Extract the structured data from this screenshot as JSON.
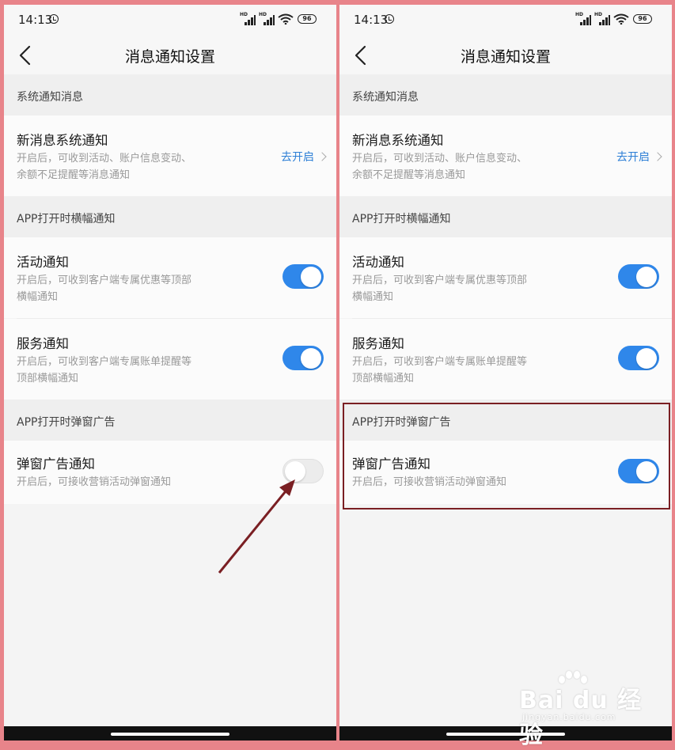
{
  "status": {
    "time": "14:13",
    "hd": "HD",
    "battery": "96"
  },
  "nav": {
    "title": "消息通知设置"
  },
  "sections": {
    "system": {
      "header": "系统通知消息"
    },
    "banner": {
      "header": "APP打开时横幅通知"
    },
    "popup": {
      "header": "APP打开时弹窗广告"
    }
  },
  "rows": {
    "new_message": {
      "title": "新消息系统通知",
      "desc_line1": "开启后，可收到活动、账户信息变动、",
      "desc_line2": "余额不足提醒等消息通知",
      "action": "去开启"
    },
    "activity": {
      "title": "活动通知",
      "desc_line1": "开启后，可收到客户端专属优惠等顶部",
      "desc_line2": "横幅通知"
    },
    "service": {
      "title": "服务通知",
      "desc_line1": "开启后，可收到客户端专属账单提醒等",
      "desc_line2": "顶部横幅通知"
    },
    "popup_ad": {
      "title": "弹窗广告通知",
      "desc": "开启后，可接收营销活动弹窗通知"
    }
  },
  "toggles": {
    "left": {
      "activity": true,
      "service": true,
      "popup_ad": false
    },
    "right": {
      "activity": true,
      "service": true,
      "popup_ad": true
    }
  },
  "colors": {
    "accent": "#2f87ea",
    "link": "#2d7fd6",
    "highlight": "#7a1f23",
    "annotation_arrow": "#7a1f23"
  },
  "watermark": {
    "logo": "Bai du 经验",
    "sub": "jingyan.baidu.com"
  }
}
